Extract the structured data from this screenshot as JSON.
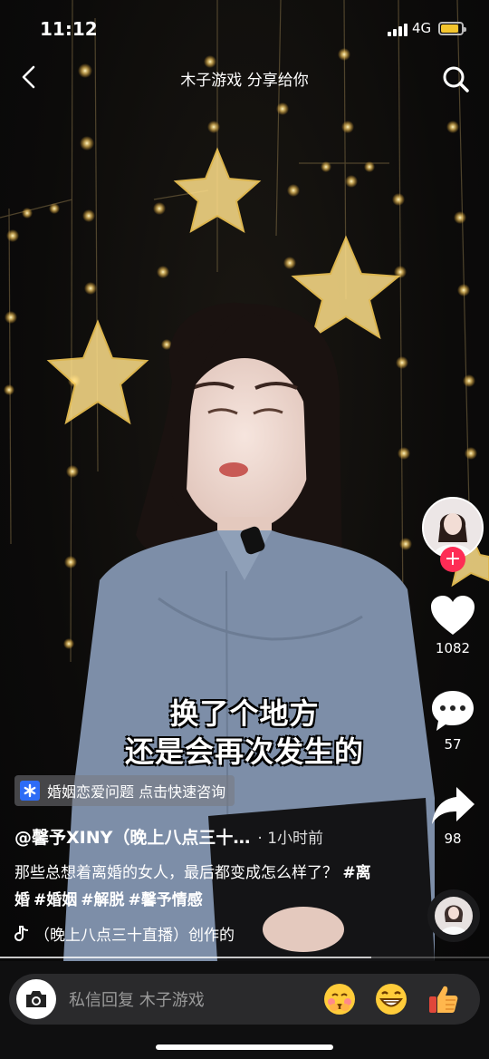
{
  "status_bar": {
    "time": "11:12",
    "network": "4G",
    "battery_level": 0.85,
    "battery_color": "#f4c52e"
  },
  "header": {
    "title": "木子游戏 分享给你"
  },
  "video": {
    "caption_line1": "换了个地方",
    "caption_line2": "还是会再次发生的",
    "progress": 0.76
  },
  "rail": {
    "likes": "1082",
    "comments": "57",
    "shares": "98",
    "follow_color": "#fe2c55"
  },
  "info": {
    "chip_label": "婚姻恋爱问题 点击快速咨询",
    "author": "@馨予XINY（晚上八点三十…",
    "time_ago": "· 1小时前",
    "desc_text": "那些总想着离婚的女人，最后都变成怎么样了？",
    "tags": [
      "#离婚",
      "#婚姻",
      "#解脱",
      "#馨予情感"
    ],
    "music": "（晚上八点三十直播）创作的"
  },
  "reply_bar": {
    "placeholder": "私信回复 木子游戏",
    "emojis": [
      "shy-emoji",
      "grin-emoji",
      "thumbs-up-emoji"
    ]
  }
}
